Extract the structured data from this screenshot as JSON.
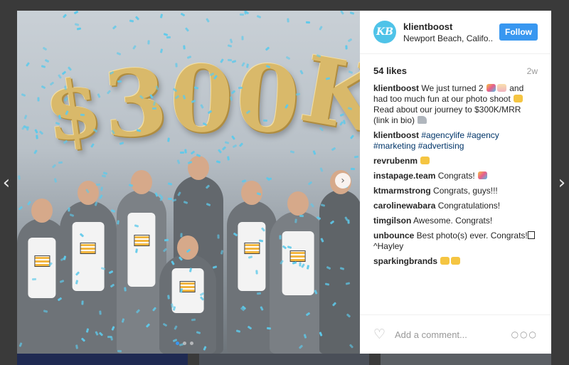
{
  "post": {
    "username": "klientboost",
    "location": "Newport Beach, Califo..",
    "avatar_text": "KB",
    "follow_label": "Follow",
    "likes": "54 likes",
    "time": "2w",
    "balloon_text": [
      "$",
      "3",
      "0",
      "0",
      "K"
    ],
    "caption": {
      "user": "klientboost",
      "text_1": "We just turned 2",
      "text_2": "and had too much fun at our photo shoot",
      "text_3": "Read about our journey to $300K/MRR (link in bio)"
    },
    "hashtags_comment": {
      "user": "klientboost",
      "tags": [
        "#agencylife",
        "#agency",
        "#marketing",
        "#advertising"
      ]
    },
    "comments": [
      {
        "user": "revrubenm",
        "text": "",
        "emoji": "yellow"
      },
      {
        "user": "instapage.team",
        "text": "Congrats!",
        "emoji": "party"
      },
      {
        "user": "ktmarmstrong",
        "text": "Congrats, guys!!!",
        "emoji": ""
      },
      {
        "user": "carolinewabara",
        "text": "Congratulations!",
        "emoji": ""
      },
      {
        "user": "timgilson",
        "text": "Awesome. Congrats!",
        "emoji": ""
      },
      {
        "user": "unbounce",
        "text": "Best photo(s) ever. Congrats!",
        "text_after": "^Hayley",
        "emoji": "box"
      },
      {
        "user": "sparkingbrands",
        "text": "",
        "emoji": "yellow"
      }
    ],
    "add_comment_placeholder": "Add a comment...",
    "more_label": "ooo"
  },
  "colors": {
    "accent": "#3897f0",
    "avatar": "#4fc3e8",
    "confetti": "#5ec9ea",
    "hashtag": "#003569"
  },
  "icons": {
    "prev": "chevron-left-icon",
    "next": "chevron-right-icon",
    "like": "heart-icon",
    "more": "more-options-icon"
  }
}
